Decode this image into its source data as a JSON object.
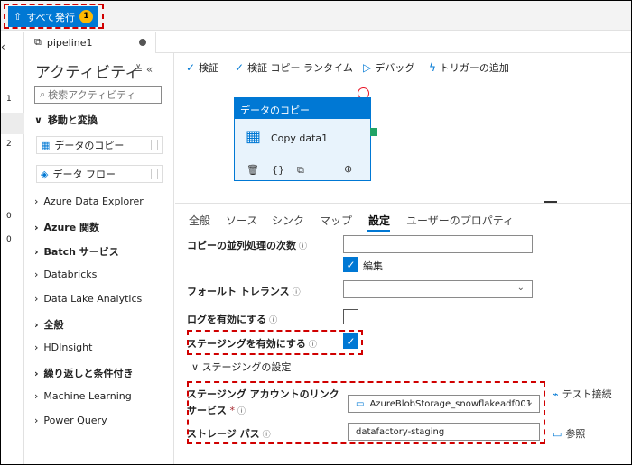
{
  "topbar": {
    "publish_label": "すべて発行",
    "publish_count": "1"
  },
  "left_strip": {
    "items": [
      "1",
      "2",
      "0",
      "0"
    ]
  },
  "tab": {
    "name": "pipeline1"
  },
  "activities": {
    "title": "アクティビティ",
    "collapse_glyph": "≚ «",
    "search_placeholder": "検索アクティビティ",
    "group_move": "移動と変換",
    "card_copy": "データのコピー",
    "card_flow": "データ フロー",
    "categories": [
      {
        "label": "Azure Data Explorer",
        "bold": false
      },
      {
        "label": "Azure 関数",
        "bold": true
      },
      {
        "label": "Batch サービス",
        "bold": true
      },
      {
        "label": "Databricks",
        "bold": false
      },
      {
        "label": "Data Lake Analytics",
        "bold": false
      },
      {
        "label": "全般",
        "bold": true
      },
      {
        "label": "HDInsight",
        "bold": false
      },
      {
        "label": "繰り返しと条件付き",
        "bold": true
      },
      {
        "label": "Machine Learning",
        "bold": false
      },
      {
        "label": "Power Query",
        "bold": false
      }
    ]
  },
  "toolbar": {
    "validate": "検証",
    "validate_copy": "検証 コピー ランタイム",
    "debug": "デバッグ",
    "add_trigger": "トリガーの追加"
  },
  "node": {
    "header": "データのコピー",
    "name": "Copy data1"
  },
  "settings_tabs": [
    "全般",
    "ソース",
    "シンク",
    "マップ",
    "設定",
    "ユーザーのプロパティ"
  ],
  "settings_active": "設定",
  "form": {
    "parallel_label": "コピーの並列処理の次数",
    "edit_label": "編集",
    "fault_label": "フォールト トレランス",
    "log_label": "ログを有効にする",
    "staging_label": "ステージングを有効にする",
    "staging_section": "ステージングの設定",
    "linked_service_label_1": "ステージング アカウントのリンク",
    "linked_service_label_2": "サービス",
    "linked_service_value": "AzureBlobStorage_snowflakeadf001",
    "test_connection": "テスト接続",
    "storage_path_label": "ストレージ パス",
    "storage_path_value": "datafactory-staging",
    "browse": "参照"
  },
  "colors": {
    "accent": "#0078d4",
    "highlight": "#d00000",
    "badge": "#ffb900",
    "success": "#21a366"
  }
}
